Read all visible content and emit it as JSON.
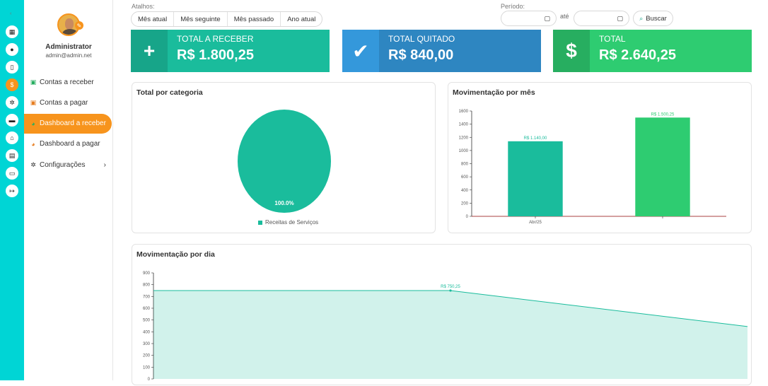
{
  "sidebar": {
    "user_name": "Administrator",
    "user_email": "admin@admin.net",
    "rail_icons": [
      "calendar-icon",
      "users-icon",
      "clipboard-icon",
      "dollar-icon",
      "gears-icon",
      "archive-icon",
      "home-icon",
      "file-icon",
      "monitor-icon",
      "logout-icon"
    ],
    "items": [
      {
        "label": "Contas a receber",
        "icon": "money-icon",
        "color": "#27ae60"
      },
      {
        "label": "Contas a pagar",
        "icon": "money-icon",
        "color": "#e67e22"
      },
      {
        "label": "Dashboard a receber",
        "icon": "pie-icon",
        "active": true
      },
      {
        "label": "Dashboard a pagar",
        "icon": "pie-icon",
        "color": "#e67e22"
      },
      {
        "label": "Configurações",
        "icon": "gears-icon",
        "has_children": true
      }
    ]
  },
  "filters": {
    "shortcuts_label": "Atalhos:",
    "shortcuts": [
      "Mês atual",
      "Mês seguinte",
      "Mês passado",
      "Ano atual"
    ],
    "period_label": "Período:",
    "between_label": "até",
    "search_label": "Buscar"
  },
  "cards": [
    {
      "title": "TOTAL A RECEBER",
      "value": "R$ 1.800,25",
      "icon": "plus-icon",
      "color": "#1abc9c",
      "icon_bg": "#17a589"
    },
    {
      "title": "TOTAL QUITADO",
      "value": "R$ 840,00",
      "icon": "check-icon",
      "color": "#2e86c1",
      "icon_bg": "#3498db"
    },
    {
      "title": "TOTAL",
      "value": "R$ 2.640,25",
      "icon": "dollar-icon",
      "color": "#2ecc71",
      "icon_bg": "#27ae60"
    }
  ],
  "panels": {
    "category_title": "Total por categoria",
    "month_title": "Movimentação por mês",
    "day_title": "Movimentação por dia"
  },
  "chart_data": [
    {
      "type": "pie",
      "slices": [
        {
          "label": "Receitas de Serviços",
          "value": 100.0,
          "display": "100.0%",
          "color": "#1abc9c"
        }
      ]
    },
    {
      "type": "bar",
      "categories": [
        "Abr/25",
        ""
      ],
      "values": [
        1140.0,
        1500.25
      ],
      "value_labels": [
        "R$ 1.140,00",
        "R$ 1.500,25"
      ],
      "colors": [
        "#1abc9c",
        "#2ecc71"
      ],
      "ylim": [
        0,
        1600
      ],
      "yticks": [
        0,
        200,
        400,
        600,
        800,
        1000,
        1200,
        1400,
        1600
      ]
    },
    {
      "type": "area",
      "values": [
        750.25,
        750.25,
        445
      ],
      "point_label": "R$ 750,25",
      "ylim": [
        0,
        900
      ],
      "yticks": [
        0,
        100,
        200,
        300,
        400,
        500,
        600,
        700,
        800,
        900
      ],
      "color": "#1abc9c"
    }
  ]
}
